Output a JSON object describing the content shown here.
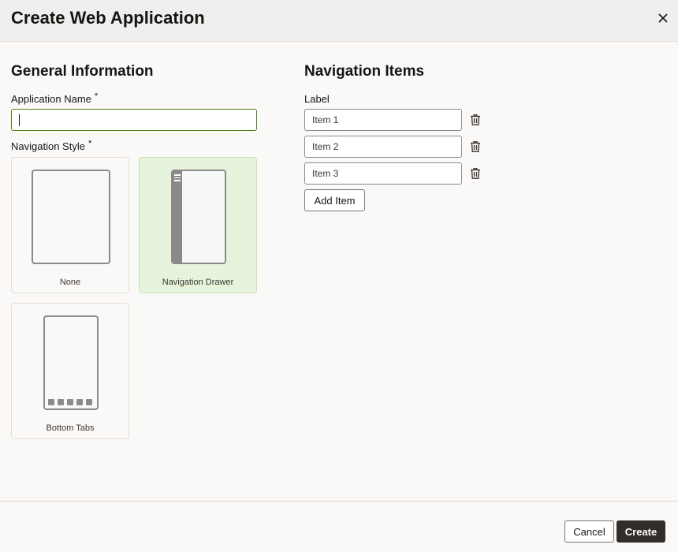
{
  "dialog": {
    "title": "Create Web Application",
    "close_icon": "close-icon"
  },
  "general": {
    "title": "General Information",
    "app_name_label": "Application Name",
    "app_name_required": "*",
    "app_name_value": "",
    "nav_style_label": "Navigation Style",
    "nav_style_required": "*",
    "styles": [
      {
        "label": "None",
        "selected": false
      },
      {
        "label": "Navigation Drawer",
        "selected": true
      },
      {
        "label": "Bottom Tabs",
        "selected": false
      }
    ]
  },
  "navigation": {
    "title": "Navigation Items",
    "label_header": "Label",
    "items": [
      {
        "value": "Item 1",
        "delete_icon": "trash-icon"
      },
      {
        "value": "Item 2",
        "delete_icon": "trash-icon"
      },
      {
        "value": "Item 3",
        "delete_icon": "trash-icon"
      }
    ],
    "add_item_label": "Add Item"
  },
  "footer": {
    "cancel_label": "Cancel",
    "create_label": "Create"
  },
  "colors": {
    "selected_tile_bg": "#e6f4dc",
    "primary_button": "#312d2a",
    "focus_border": "#4f7d1a"
  }
}
